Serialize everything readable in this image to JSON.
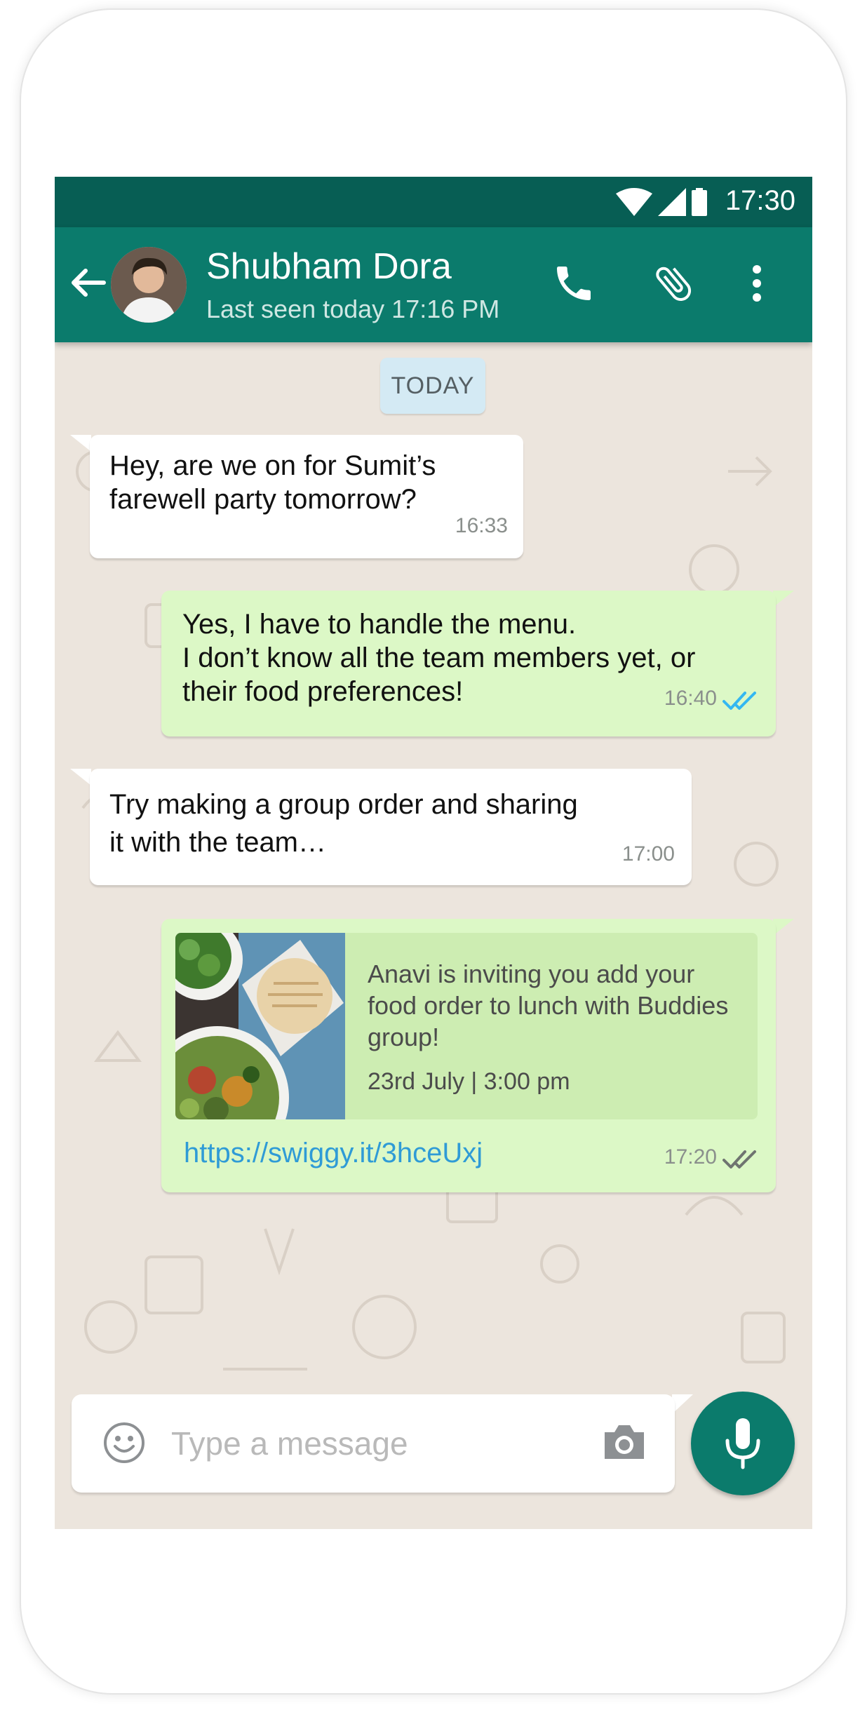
{
  "status_bar": {
    "time": "17:30"
  },
  "header": {
    "contact_name": "Shubham Dora",
    "last_seen": "Last seen today 17:16 PM"
  },
  "chat": {
    "day_label": "TODAY",
    "messages": [
      {
        "direction": "incoming",
        "text": "Hey, are we on for Sumit’s\nfarewell party tomorrow?",
        "time": "16:33"
      },
      {
        "direction": "outgoing",
        "text": "Yes, I have to handle the menu.\nI don’t know all the team members yet, or\ntheir food preferences!",
        "time": "16:40",
        "status": "read"
      },
      {
        "direction": "incoming",
        "text": "Try making a group order and sharing\nit with the team…",
        "time": "17:00"
      },
      {
        "direction": "outgoing",
        "card": {
          "text": "Anavi is inviting you add your food order to lunch with Buddies group!",
          "date": "23rd July | 3:00 pm"
        },
        "link": "https://swiggy.it/3hceUxj",
        "time": "17:20",
        "status": "delivered"
      }
    ]
  },
  "composer": {
    "placeholder": "Type a message"
  },
  "icons": [
    "wifi-icon",
    "signal-icon",
    "battery-icon",
    "back-arrow-icon",
    "phone-icon",
    "attach-icon",
    "more-vert-icon",
    "emoji-icon",
    "camera-icon",
    "mic-icon",
    "double-check-icon"
  ],
  "colors": {
    "header": "#0b7b6c",
    "status_bar": "#075e54",
    "chat_background": "#ece5dd",
    "incoming_bubble": "#ffffff",
    "outgoing_bubble": "#dcf8c6",
    "read_ticks": "#34b7f1",
    "link": "#2f9bd6"
  }
}
